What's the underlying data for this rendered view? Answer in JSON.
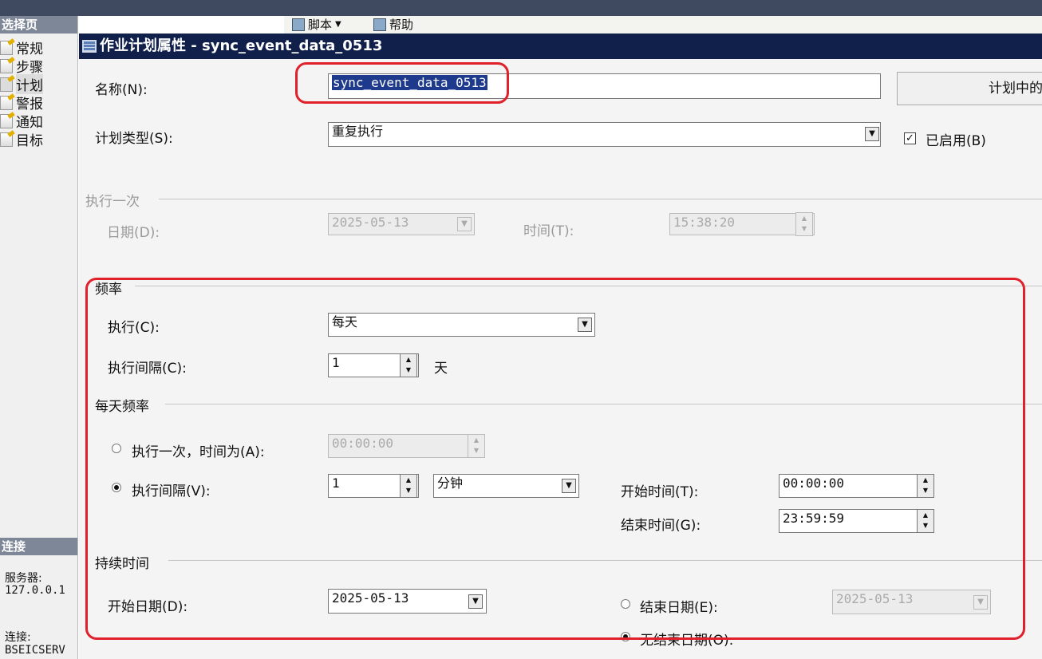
{
  "parent": {
    "toolbar": {
      "script_label": "脚本",
      "help_label": "帮助"
    },
    "select_page_header": "选择页",
    "nav_items": [
      "常规",
      "步骤",
      "计划",
      "警报",
      "通知",
      "目标"
    ],
    "connection_header": "连接",
    "server_label": "服务器:",
    "server_value": "127.0.0.1",
    "connection_label": "连接:",
    "connection_value": "BSEICSERV"
  },
  "dialog": {
    "title": "作业计划属性 - sync_event_data_0513",
    "name_label": "名称(N):",
    "name_value": "sync_event_data_0513",
    "jobs_in_schedule_button": "计划中的",
    "schedule_type_label": "计划类型(S):",
    "schedule_type_value": "重复执行",
    "enabled_label": "已启用(B)",
    "enabled_checked": true,
    "one_time": {
      "group_label": "执行一次",
      "date_label": "日期(D):",
      "date_value": "2025-05-13",
      "time_label": "时间(T):",
      "time_value": "15:38:20"
    },
    "frequency": {
      "group_label": "频率",
      "occurs_label": "执行(C):",
      "occurs_value": "每天",
      "recurs_label": "执行间隔(C):",
      "recurs_value": "1",
      "recurs_unit": "天"
    },
    "daily_frequency": {
      "group_label": "每天频率",
      "once_label": "执行一次，时间为(A):",
      "once_value": "00:00:00",
      "every_label": "执行间隔(V):",
      "every_value": "1",
      "every_unit": "分钟",
      "start_time_label": "开始时间(T):",
      "start_time_value": "00:00:00",
      "end_time_label": "结束时间(G):",
      "end_time_value": "23:59:59",
      "selected_option": "every"
    },
    "duration": {
      "group_label": "持续时间",
      "start_date_label": "开始日期(D):",
      "start_date_value": "2025-05-13",
      "end_date_label": "结束日期(E):",
      "end_date_value": "2025-05-13",
      "no_end_date_label": "无结束日期(O):",
      "selected_option": "no_end_date"
    }
  }
}
